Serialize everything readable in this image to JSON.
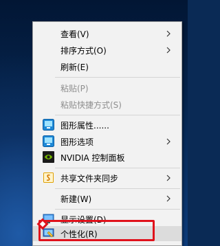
{
  "menu": {
    "items": [
      {
        "label": "查看(V)"
      },
      {
        "label": "排序方式(O)"
      },
      {
        "label": "刷新(E)"
      },
      {
        "label": "粘贴(P)"
      },
      {
        "label": "粘贴快捷方式(S)"
      },
      {
        "label": "图形属性......"
      },
      {
        "label": "图形选项"
      },
      {
        "label": "NVIDIA 控制面板"
      },
      {
        "label": "共享文件夹同步"
      },
      {
        "label": "新建(W)"
      },
      {
        "label": "显示设置(D)"
      },
      {
        "label": "个性化(R)"
      }
    ]
  },
  "annotation": {
    "color": "#e0111b"
  }
}
